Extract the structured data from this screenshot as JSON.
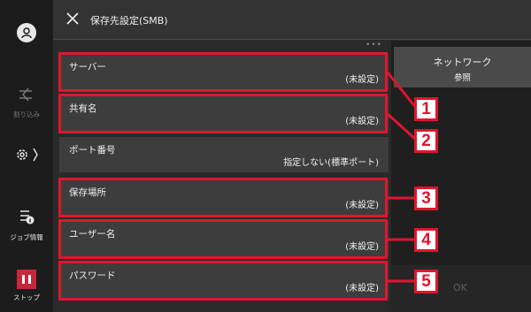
{
  "header": {
    "title": "保存先設定(SMB)",
    "close_icon": "close-icon"
  },
  "sidebar": {
    "items": [
      {
        "label": "",
        "icon": "user-icon"
      },
      {
        "label": "割り込み",
        "icon": "interrupt-icon"
      },
      {
        "label": "",
        "icon": "gear-icon"
      },
      {
        "label": "ジョブ情報",
        "icon": "job-info-icon"
      },
      {
        "label": "ストップ",
        "icon": "stop-icon"
      }
    ],
    "stop_color": "#c4283d"
  },
  "list": {
    "more_indicator": "•••",
    "rows": [
      {
        "label": "サーバー",
        "value": "(未設定)"
      },
      {
        "label": "共有名",
        "value": "(未設定)"
      },
      {
        "label": "ポート番号",
        "value": "指定しない(標準ポート)"
      },
      {
        "label": "保存場所",
        "value": "(未設定)"
      },
      {
        "label": "ユーザー名",
        "value": "(未設定)"
      },
      {
        "label": "パスワード",
        "value": "(未設定)"
      }
    ]
  },
  "right_panel": {
    "network_button": {
      "line1": "ネットワーク",
      "line2": "参照"
    },
    "ok_label": "OK"
  },
  "callouts": [
    "1",
    "2",
    "3",
    "4",
    "5"
  ],
  "colors": {
    "highlight": "#e0152d",
    "background": "#2b2b2b",
    "row": "#3d3d3d"
  }
}
